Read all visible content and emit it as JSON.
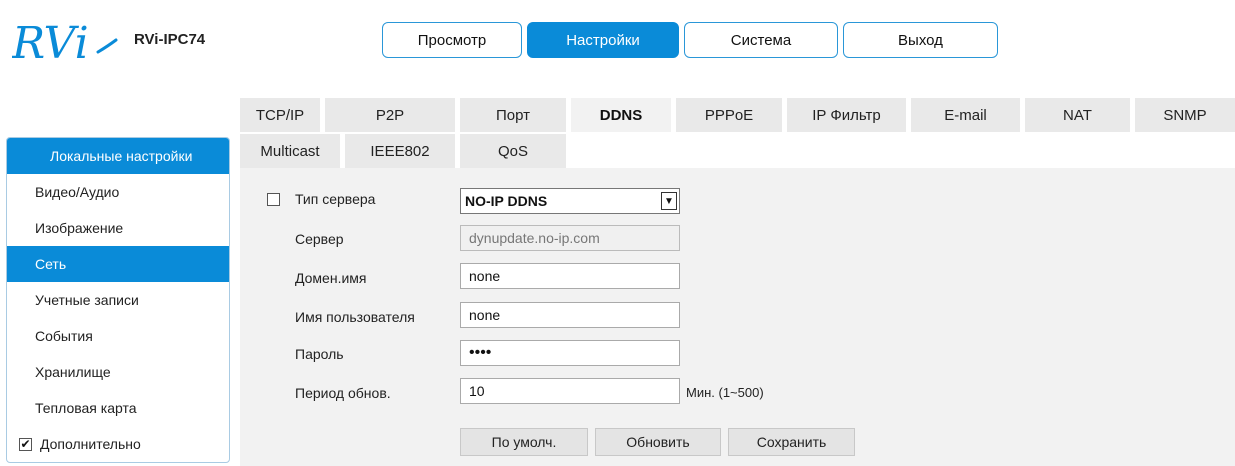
{
  "header": {
    "model": "RVi-IPC74",
    "logo_icon": "rvi-logo-icon",
    "brand_color": "#0a8bd8",
    "nav": [
      {
        "label": "Просмотр"
      },
      {
        "label": "Настройки"
      },
      {
        "label": "Система"
      },
      {
        "label": "Выход"
      }
    ]
  },
  "tabs_row1": [
    {
      "label": "TCP/IP"
    },
    {
      "label": "P2P"
    },
    {
      "label": "Порт"
    },
    {
      "label": "DDNS"
    },
    {
      "label": "PPPoE"
    },
    {
      "label": "IP Фильтр"
    },
    {
      "label": "E-mail"
    },
    {
      "label": "NAT"
    },
    {
      "label": "SNMP"
    }
  ],
  "tabs_row2": [
    {
      "label": "Multicast"
    },
    {
      "label": "IEEE802"
    },
    {
      "label": "QoS"
    }
  ],
  "sidebar": {
    "items": [
      {
        "label": "Локальные настройки"
      },
      {
        "label": "Видео/Аудио"
      },
      {
        "label": "Изображение"
      },
      {
        "label": "Сеть"
      },
      {
        "label": "Учетные записи"
      },
      {
        "label": "События"
      },
      {
        "label": "Хранилище"
      },
      {
        "label": "Тепловая карта"
      }
    ],
    "advanced": {
      "label": "Дополнительно",
      "check_mark": "✔"
    }
  },
  "form": {
    "server_type": {
      "label": "Тип сервера",
      "value": "NO-IP DDNS",
      "arrow": "▼"
    },
    "server": {
      "label": "Сервер",
      "value": "dynupdate.no-ip.com"
    },
    "domain": {
      "label": "Домен.имя",
      "value": "none"
    },
    "username": {
      "label": "Имя пользователя",
      "value": "none"
    },
    "password": {
      "label": "Пароль",
      "value": "1234"
    },
    "period": {
      "label": "Период обнов.",
      "value": "10",
      "unit": "Мин. (1~500)"
    }
  },
  "buttons": {
    "default": "По умолч.",
    "refresh": "Обновить",
    "save": "Сохранить"
  }
}
